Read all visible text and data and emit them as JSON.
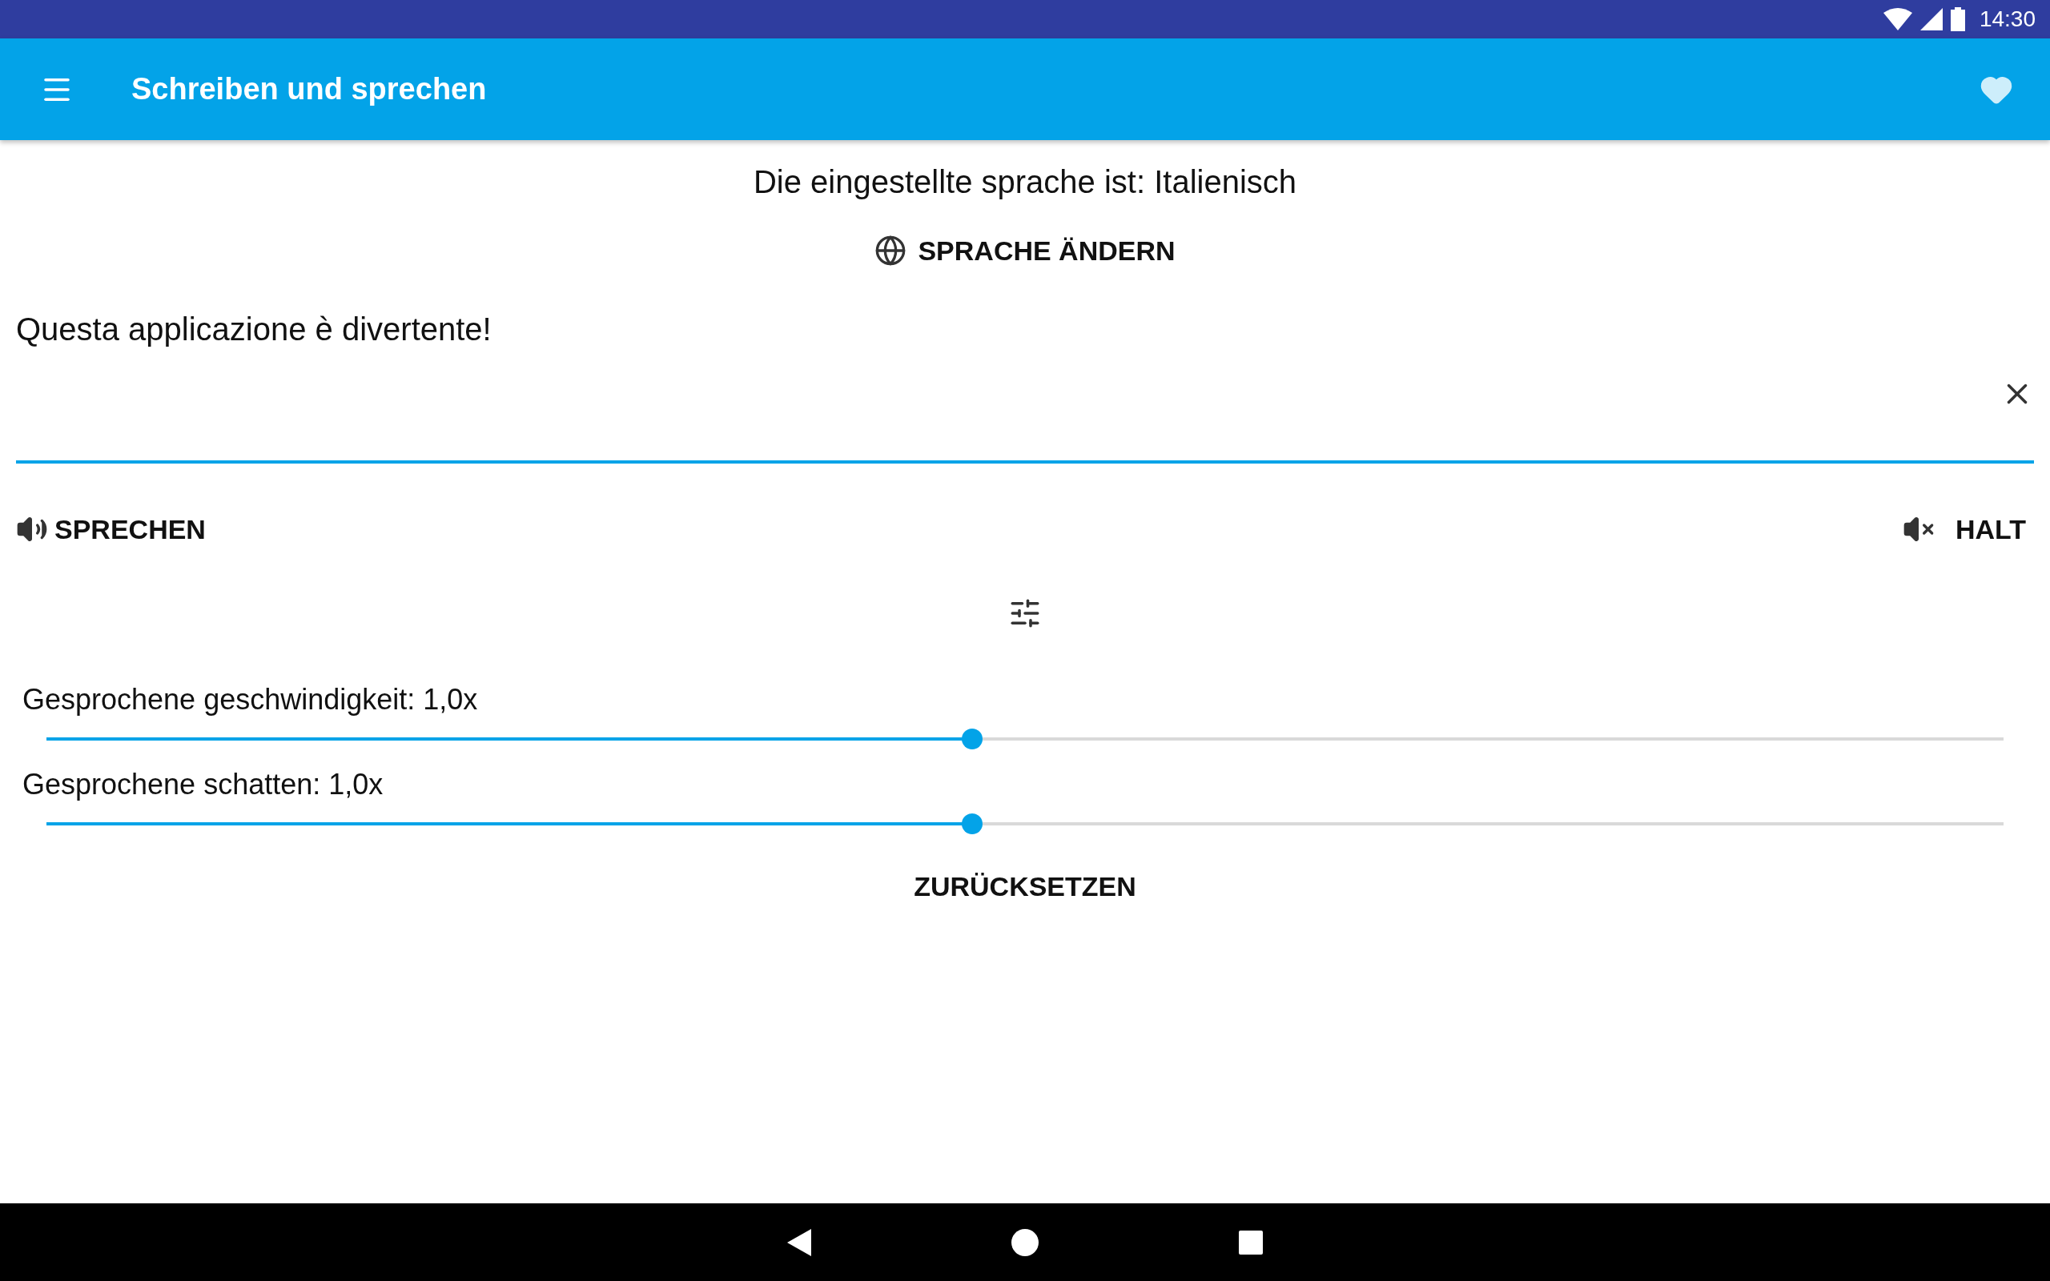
{
  "status_bar": {
    "time": "14:30"
  },
  "toolbar": {
    "title": "Schreiben und sprechen"
  },
  "language_info": "Die eingestellte sprache ist: Italienisch",
  "change_language_button": "SPRACHE ÄNDERN",
  "text_input": {
    "value": "Questa applicazione è divertente!"
  },
  "speak_button": "SPRECHEN",
  "stop_button": "HALT",
  "sliders": [
    {
      "label": "Gesprochene geschwindigkeit: 1,0x",
      "level": 0.473
    },
    {
      "label": "Gesprochene schatten: 1,0x",
      "level": 0.473
    }
  ],
  "reset_button": "ZURÜCKSETZEN"
}
